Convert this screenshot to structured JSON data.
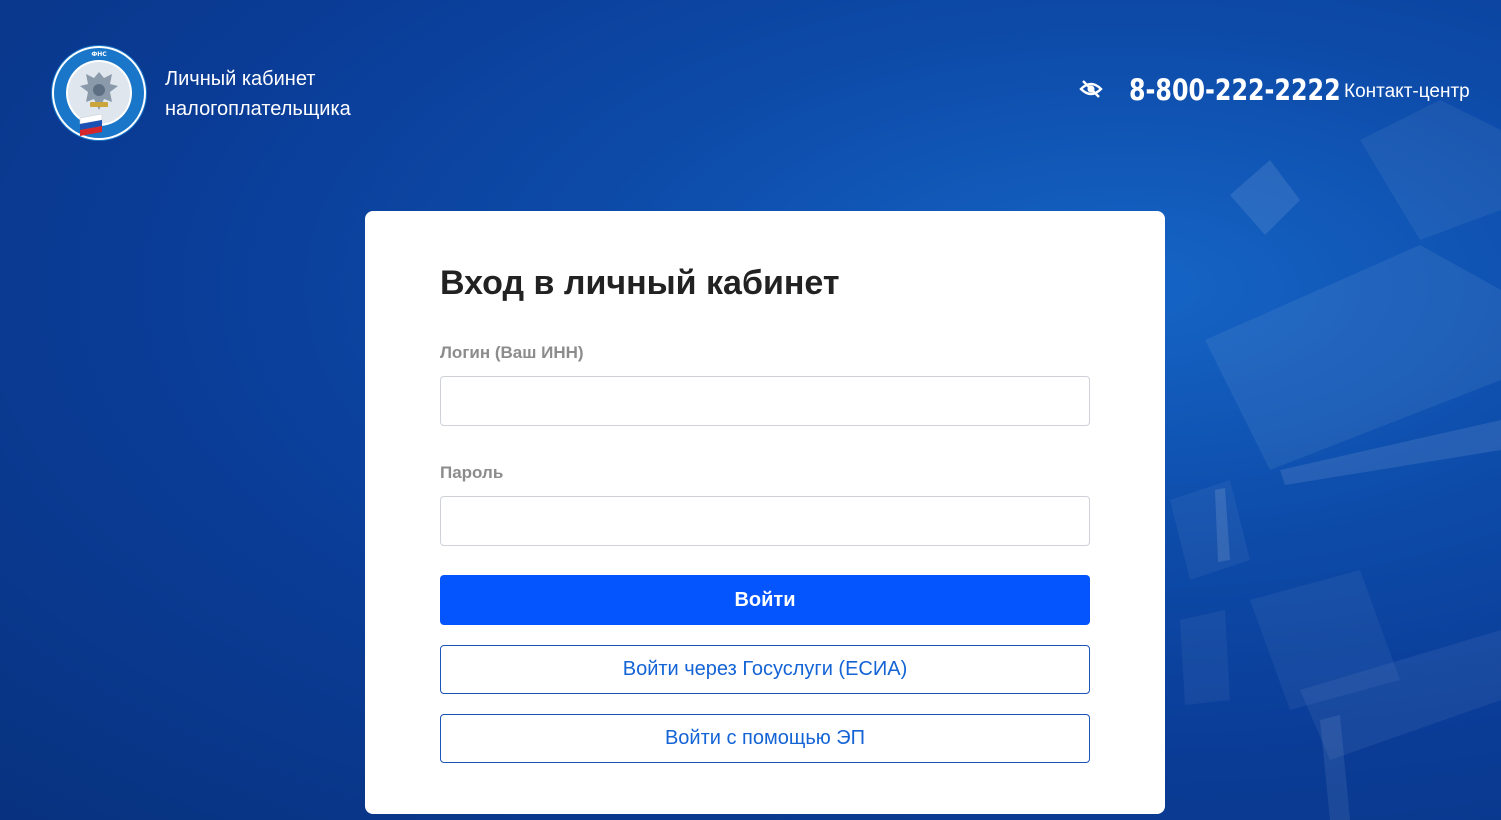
{
  "header": {
    "brand_line1": "Личный кабинет",
    "brand_line2": "налогоплательщика",
    "logo_text": "ФЕДЕРАЛЬНАЯ НАЛОГОВАЯ СЛУЖБА",
    "phone": "8-800-222-2222",
    "contact_center": "Контакт-центр",
    "accessibility_icon": "eye-slash-icon"
  },
  "login": {
    "title": "Вход в личный кабинет",
    "login_label": "Логин (Ваш ИНН)",
    "login_value": "",
    "password_label": "Пароль",
    "password_value": "",
    "submit_label": "Войти",
    "gosuslugi_label": "Войти через Госуслуги (ЕСИА)",
    "ep_label": "Войти с помощью ЭП"
  },
  "colors": {
    "background": "#0a3d98",
    "card": "#ffffff",
    "primary_button": "#0555ff",
    "outline_text": "#1464d6",
    "label": "#8c8c8c",
    "title": "#222222"
  }
}
